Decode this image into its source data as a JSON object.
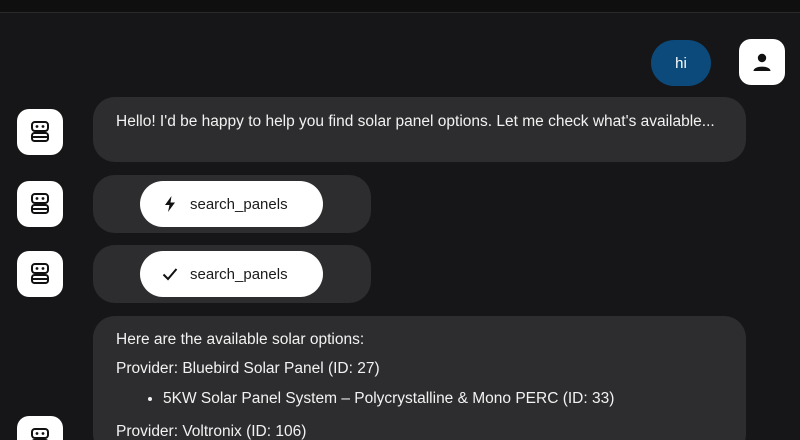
{
  "user": {
    "message": "hi",
    "avatar_icon": "person-icon"
  },
  "assistant": {
    "avatar_icon": "robot-icon",
    "intro_message": "Hello! I'd be happy to help you find solar panel options. Let me check what's available...",
    "tool_calls": [
      {
        "name": "search_panels",
        "status": "running",
        "icon": "lightning-icon"
      },
      {
        "name": "search_panels",
        "status": "done",
        "icon": "check-icon"
      }
    ],
    "results": {
      "heading": "Here are the available solar options:",
      "providers": [
        {
          "label": "Provider: Bluebird Solar Panel (ID: 27)",
          "items": [
            "5KW Solar Panel System – Polycrystalline & Mono PERC (ID: 33)"
          ]
        },
        {
          "label": "Provider: Voltronix (ID: 106)",
          "items": []
        }
      ]
    }
  },
  "colors": {
    "background": "#161618",
    "bubble": "#2d2d2f",
    "user_bubble": "#0b4a7a",
    "pill": "#ffffff"
  }
}
